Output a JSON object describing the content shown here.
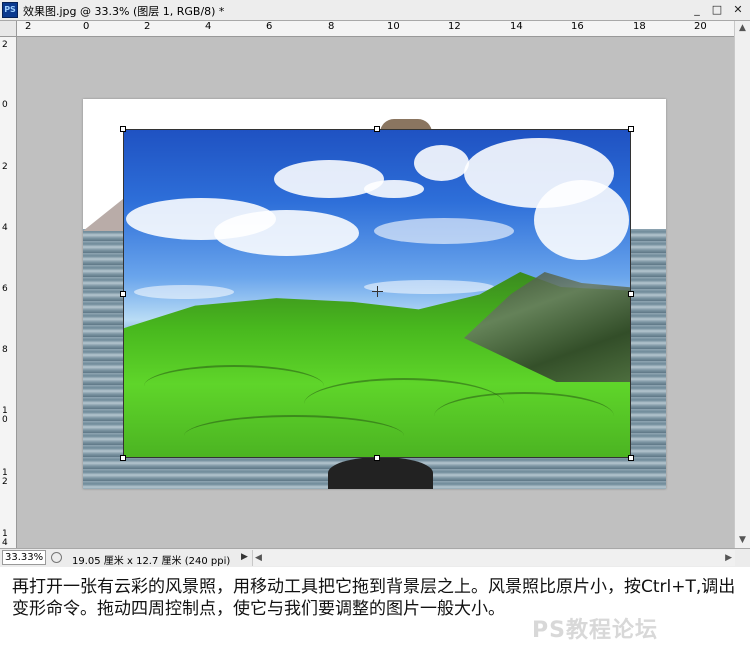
{
  "window": {
    "app_icon": "PS",
    "title": "效果图.jpg @ 33.3% (图层 1, RGB/8) *",
    "buttons": {
      "minimize": "_",
      "maximize": "□",
      "close": "✕"
    }
  },
  "rulers": {
    "horizontal": [
      "2",
      "0",
      "2",
      "4",
      "6",
      "8",
      "10",
      "12",
      "14",
      "16",
      "18",
      "20"
    ],
    "vertical": [
      "2",
      "0",
      "2",
      "4",
      "6",
      "8",
      "10",
      "12",
      "14"
    ]
  },
  "status_bar": {
    "zoom": "33.33%",
    "doc_info": "19.05 厘米 x 12.7 厘米 (240 ppi)"
  },
  "caption": "再打开一张有云彩的风景照，用移动工具把它拖到背景层之上。风景照比原片小，按Ctrl+T,调出变形命令。拖动四周控制点，使它与我们要调整的图片一般大小。",
  "watermark": "PS教程论坛",
  "icons": [
    "ps-app-icon",
    "minimize-icon",
    "maximize-icon",
    "close-icon",
    "status-info-icon",
    "chevron-right-icon",
    "scroll-up-icon",
    "scroll-down-icon",
    "scroll-left-icon",
    "scroll-right-icon",
    "transform-center-icon"
  ]
}
